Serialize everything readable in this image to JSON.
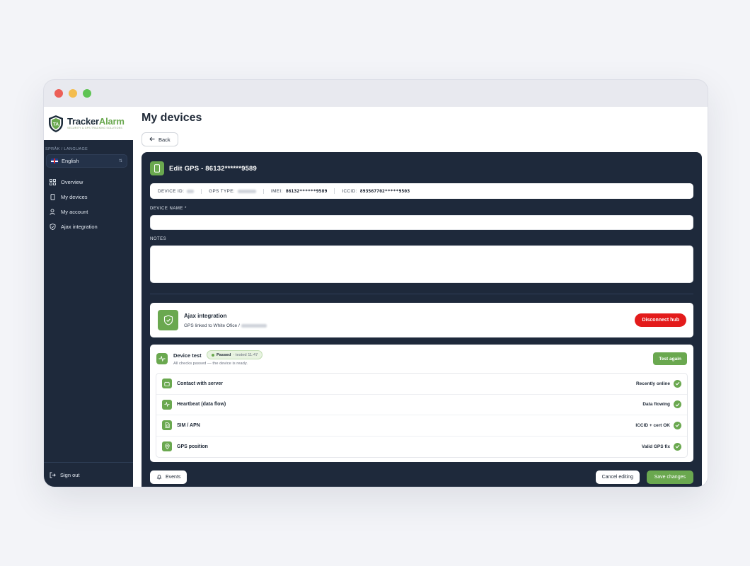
{
  "window": {
    "controls": [
      "close",
      "minimize",
      "maximize"
    ]
  },
  "brand": {
    "name_part1": "Tracker",
    "name_part2": "Alarm",
    "tagline": "SECURITY & GPS TRACKING SOLUTIONS",
    "monogram": "TA",
    "accent": "#6aa84f",
    "dark": "#1e293b"
  },
  "sidebar": {
    "language_label": "SPRÅK / LANGUAGE",
    "language_value": "English",
    "items": [
      {
        "label": "Overview",
        "icon": "grid-icon"
      },
      {
        "label": "My devices",
        "icon": "phone-icon"
      },
      {
        "label": "My account",
        "icon": "user-icon"
      },
      {
        "label": "Ajax integration",
        "icon": "shield-icon"
      }
    ],
    "sign_out": "Sign out"
  },
  "page": {
    "title": "My devices",
    "back_label": "Back"
  },
  "edit": {
    "title": "Edit GPS - 86132******9589",
    "device_id_label": "DEVICE ID:",
    "gps_type_label": "GPS TYPE:",
    "imei_label": "IMEI:",
    "imei_value": "86132******9589",
    "iccid_label": "ICCID:",
    "iccid_value": "893567702*****9503",
    "device_name_label": "DEVICE NAME *",
    "device_name_value": "",
    "notes_label": "NOTES",
    "notes_value": ""
  },
  "ajax": {
    "title": "Ajax integration",
    "subtitle": "GPS linked to White Ofice /",
    "disconnect_label": "Disconnect hub",
    "disconnect_color": "#e31b1b"
  },
  "device_test": {
    "title": "Device test",
    "status": "Passed",
    "tested_time": "· tested 11:47",
    "subtitle": "All checks passed — the device is ready.",
    "test_again_label": "Test again",
    "checks": [
      {
        "label": "Contact with server",
        "status": "Recently online",
        "icon": "server-icon"
      },
      {
        "label": "Heartbeat (data flow)",
        "status": "Data flowing",
        "icon": "pulse-icon"
      },
      {
        "label": "SIM / APN",
        "status": "ICCID + cert OK",
        "icon": "sim-icon"
      },
      {
        "label": "GPS position",
        "status": "Valid GPS fix",
        "icon": "location-icon"
      }
    ]
  },
  "footer": {
    "events_label": "Events",
    "cancel_label": "Cancel editing",
    "save_label": "Save changes"
  }
}
